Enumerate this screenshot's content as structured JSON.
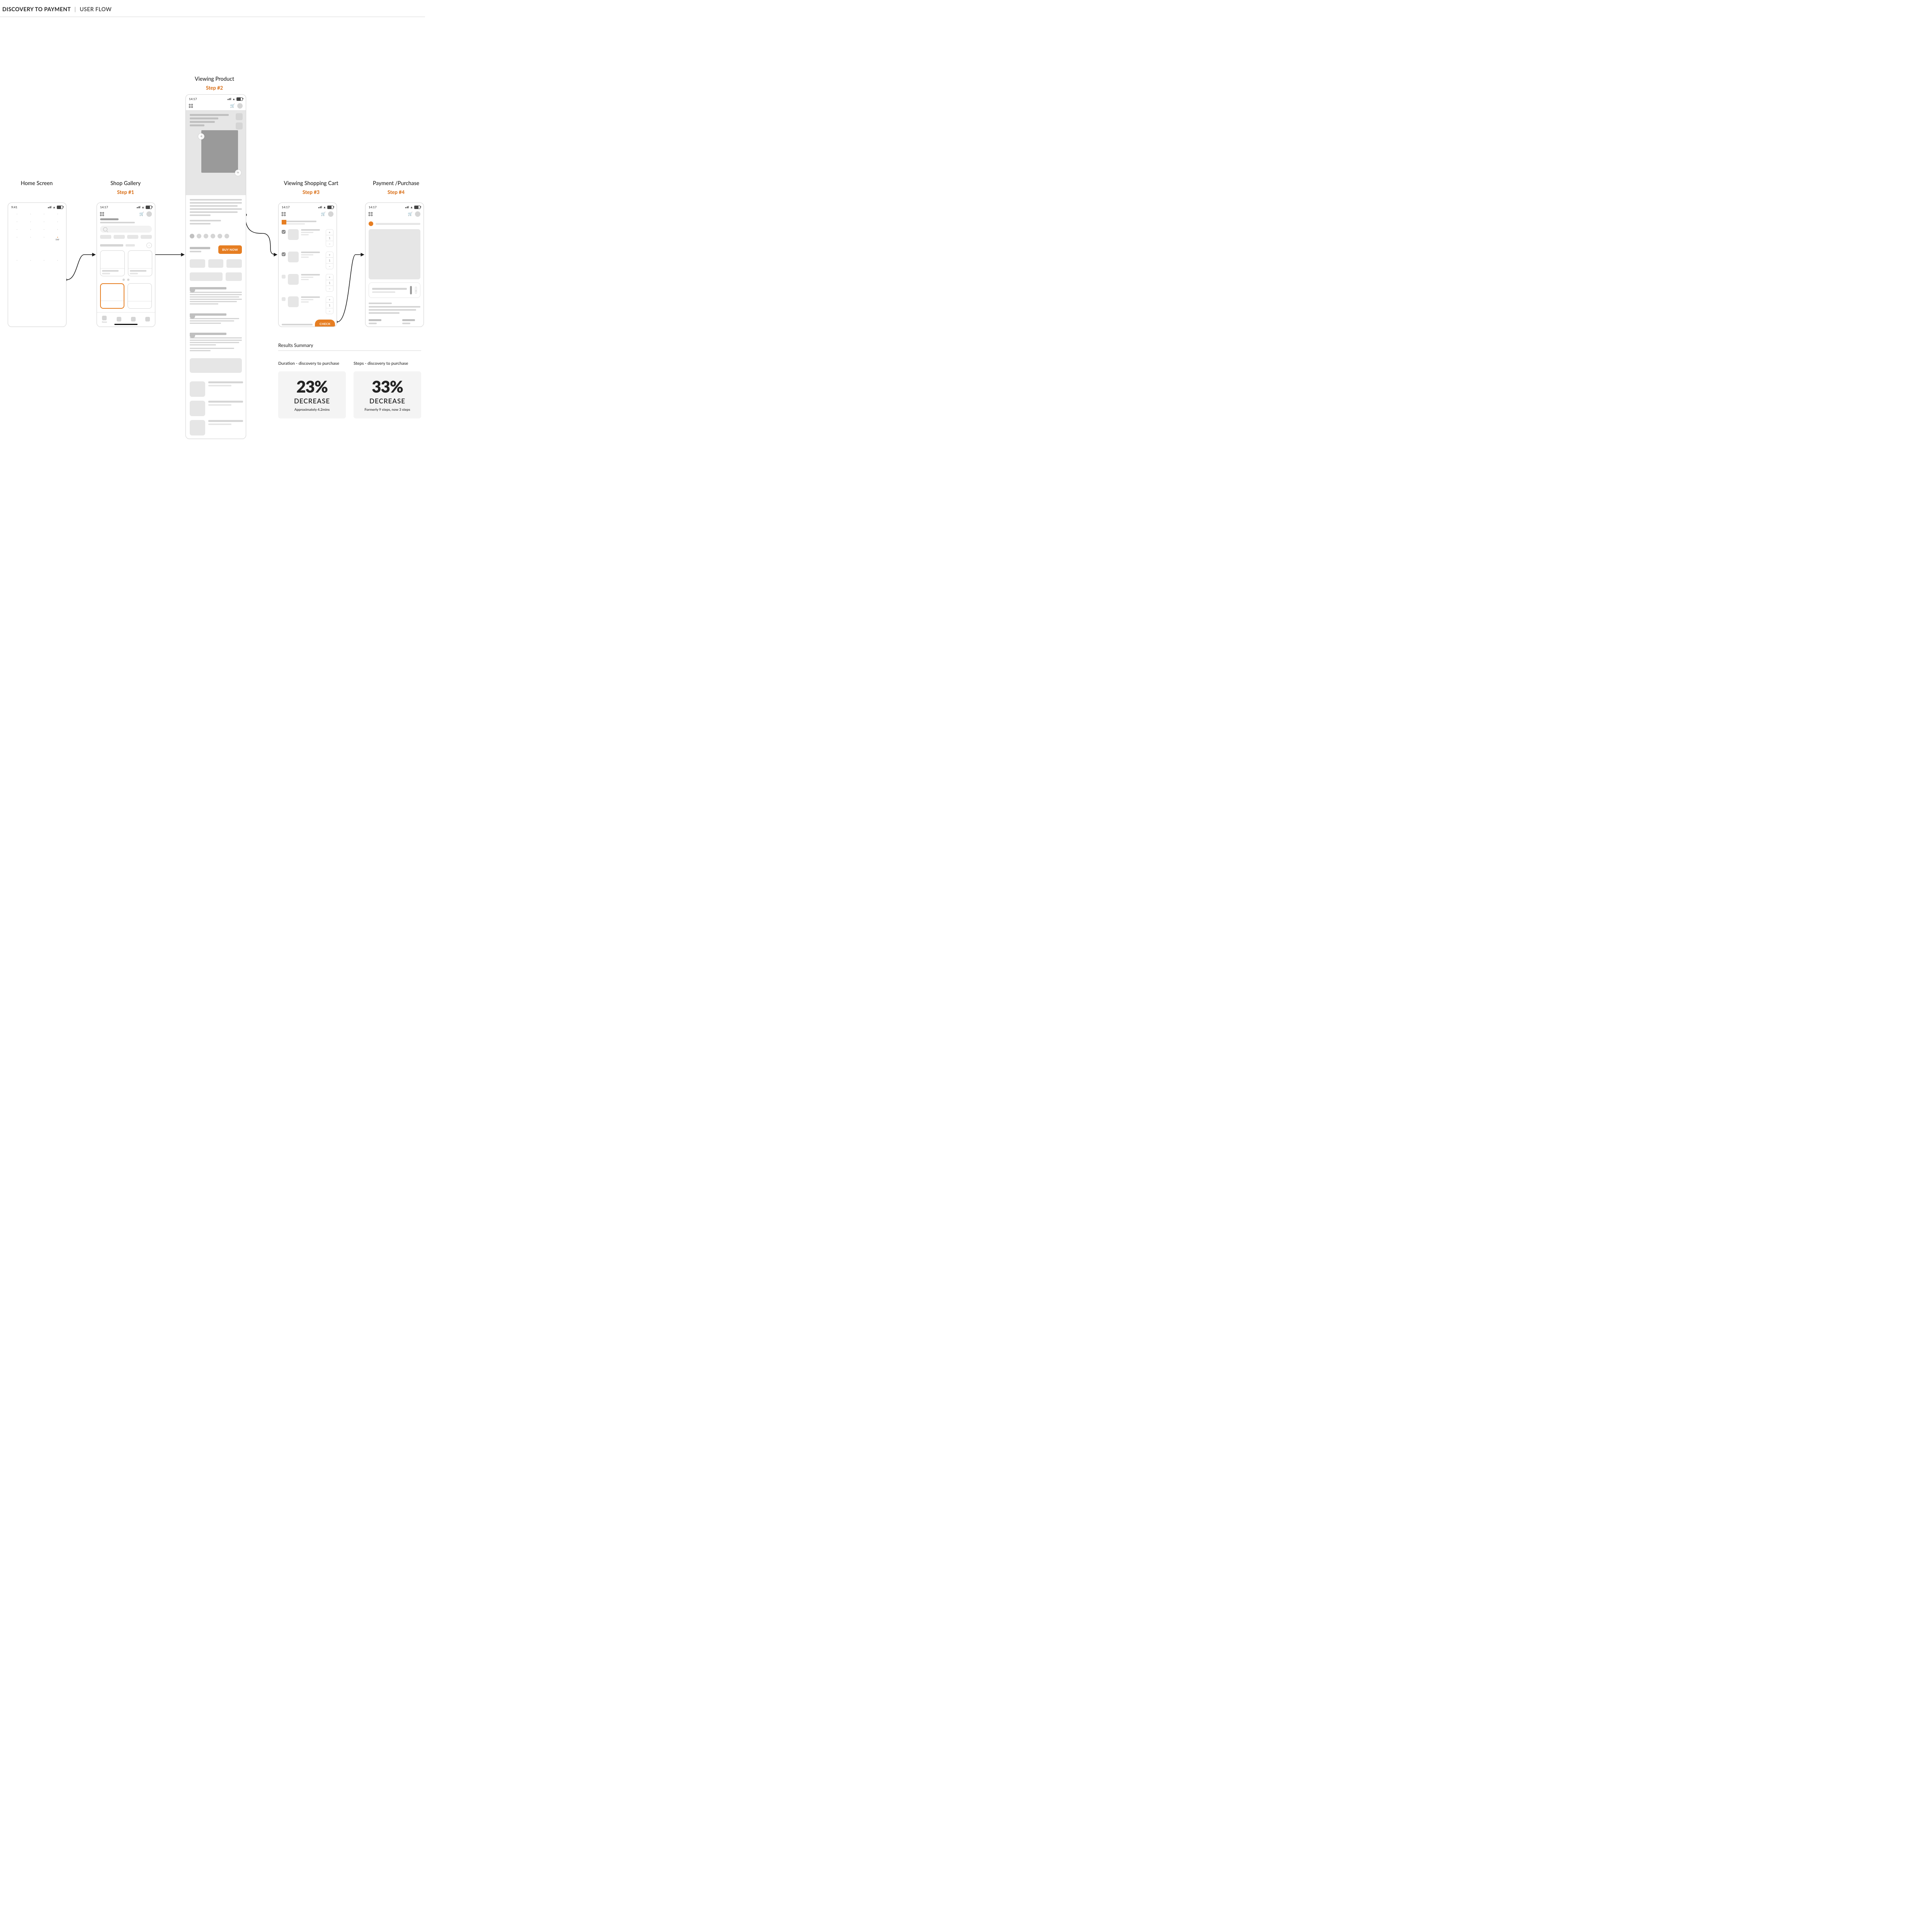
{
  "header": {
    "title": "DISCOVERY TO PAYMENT",
    "subtitle": "USER FLOW",
    "divider": "|"
  },
  "columns": {
    "home": {
      "name": "Home Screen",
      "step": ""
    },
    "gallery": {
      "name": "Shop Gallery",
      "step": "Step #1"
    },
    "product": {
      "name": "Viewing Product",
      "step": "Step #2"
    },
    "cart": {
      "name": "Viewing Shopping Cart",
      "step": "Step #3"
    },
    "payment": {
      "name": "Payment /Purchase",
      "step": "Step #4"
    }
  },
  "status": {
    "time_home": "9:41",
    "time_app": "14:17"
  },
  "home": {
    "active_app_label": "SW"
  },
  "gallery": {
    "tab_home": "Home"
  },
  "product": {
    "buy_label": "BUY NOW"
  },
  "cart": {
    "checkout_label": "CHECK OUT",
    "items": [
      {
        "checked": true,
        "qty": "1"
      },
      {
        "checked": true,
        "qty": "1"
      },
      {
        "checked": false,
        "qty": "1"
      },
      {
        "checked": false,
        "qty": "1"
      }
    ],
    "stepper_plus": "+",
    "stepper_minus": "−"
  },
  "results": {
    "heading": "Results Summary",
    "duration": {
      "label": "Duration - discovery to purchase",
      "value": "23%",
      "verb": "DECREASE",
      "note": "Approximately 4.2mins"
    },
    "steps": {
      "label": "Steps - discovery to purchase",
      "value": "33%",
      "verb": "DECREASE",
      "note": "Formerly 9 steps, now 3 steps"
    }
  }
}
